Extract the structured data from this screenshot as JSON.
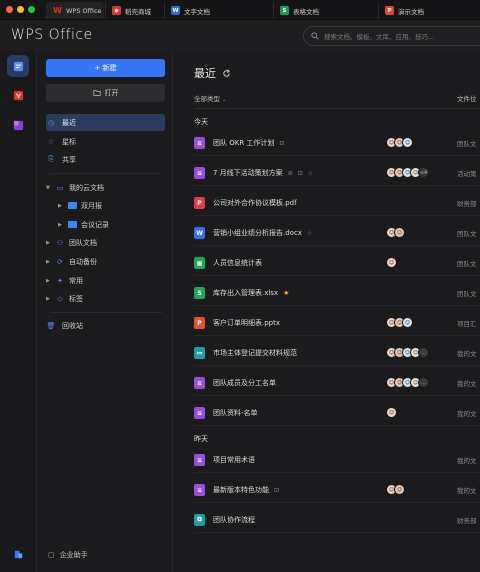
{
  "tabs": [
    {
      "label": "WPS Office",
      "icon": "wps-logo-icon",
      "color": "#e0301e"
    },
    {
      "label": "稻壳商城",
      "icon": "docer-store-icon",
      "color": "#d83a2a"
    },
    {
      "label": "文字文档",
      "icon": "W",
      "color": "#2f6ae6"
    },
    {
      "label": "表格文档",
      "icon": "S",
      "color": "#1c9b5a"
    },
    {
      "label": "演示文档",
      "icon": "P",
      "color": "#e2452b"
    }
  ],
  "header": {
    "app_title": "WPS Office",
    "search_placeholder": "搜索文档、模板、文库、应用、技巧..."
  },
  "sidebar": {
    "new_label": "+ 新建",
    "open_label": "打开",
    "nav": [
      {
        "label": "最近",
        "icon": "clock-icon"
      },
      {
        "label": "星标",
        "icon": "star-icon"
      },
      {
        "label": "共享",
        "icon": "share-icon"
      }
    ],
    "tree": [
      {
        "label": "我的云文档",
        "icon": "folder-outline-icon"
      },
      {
        "label": "双月报",
        "icon": "folder-icon"
      },
      {
        "label": "会议记录",
        "icon": "folder-icon"
      },
      {
        "label": "团队文档",
        "icon": "team-icon"
      },
      {
        "label": "自动备份",
        "icon": "backup-icon"
      },
      {
        "label": "常用",
        "icon": "pin-icon"
      },
      {
        "label": "标签",
        "icon": "tag-icon"
      }
    ],
    "trash_label": "回收站",
    "helper_label": "企业助手"
  },
  "main": {
    "title": "最近",
    "filter_label": "全部类型",
    "location_header": "文件位",
    "groups": [
      {
        "label": "今天",
        "files": [
          {
            "name": "团队 OKR 工作计划",
            "type": "doc",
            "icon": "≡",
            "color": "#9b4ddb",
            "marks": [
              "lock-icon"
            ],
            "avatars": 3,
            "more": "",
            "location": "团队文"
          },
          {
            "name": "7 月线下活动策划方案",
            "type": "doc",
            "icon": "≡",
            "color": "#9b4ddb",
            "marks": [
              "link-icon",
              "lock-icon",
              "star-icon"
            ],
            "avatars": 4,
            "more": "+4",
            "location": "活动策"
          },
          {
            "name": "公司对外合作协议模板.pdf",
            "type": "pdf",
            "icon": "P",
            "color": "#e03b4a",
            "marks": [],
            "avatars": 0,
            "more": "",
            "location": "财务部"
          },
          {
            "name": "营销小组业绩分析报告.docx",
            "type": "docx",
            "icon": "W",
            "color": "#3a6de8",
            "marks": [
              "star-icon"
            ],
            "avatars": 2,
            "more": "",
            "location": "团队文"
          },
          {
            "name": "人员信息统计表",
            "type": "sheet",
            "icon": "▦",
            "color": "#22a55d",
            "marks": [],
            "avatars": 1,
            "more": "",
            "location": "团队文"
          },
          {
            "name": "库存出入管理表.xlsx",
            "type": "xlsx",
            "icon": "S",
            "color": "#22a55d",
            "marks": [
              "star-filled-icon"
            ],
            "avatars": 0,
            "more": "",
            "location": "团队文"
          },
          {
            "name": "客户订单明细表.pptx",
            "type": "pptx",
            "icon": "P",
            "color": "#e5532c",
            "marks": [],
            "avatars": 3,
            "more": "",
            "location": "项目汇"
          },
          {
            "name": "市场主体登记提交材料规范",
            "type": "form",
            "icon": "≔",
            "color": "#1f9aa8",
            "marks": [],
            "avatars": 4,
            "more": "…",
            "location": "我的文"
          },
          {
            "name": "团队成员及分工名单",
            "type": "doc",
            "icon": "≡",
            "color": "#9b4ddb",
            "marks": [],
            "avatars": 4,
            "more": "…",
            "location": "我的文"
          },
          {
            "name": "团队资料-名单",
            "type": "doc",
            "icon": "≡",
            "color": "#9b4ddb",
            "marks": [],
            "avatars": 1,
            "more": "",
            "location": "我的文"
          }
        ]
      },
      {
        "label": "昨天",
        "files": [
          {
            "name": "项目常用术语",
            "type": "doc",
            "icon": "≡",
            "color": "#9b4ddb",
            "marks": [],
            "avatars": 0,
            "more": "",
            "location": "我的文"
          },
          {
            "name": "最新版本特色功能",
            "type": "doc",
            "icon": "≡",
            "color": "#9b4ddb",
            "marks": [
              "lock-icon"
            ],
            "avatars": 2,
            "more": "",
            "location": "我的文"
          },
          {
            "name": "团队协作流程",
            "type": "flow",
            "icon": "⧉",
            "color": "#1f9aa8",
            "marks": [],
            "avatars": 0,
            "more": "",
            "location": "财务部"
          }
        ]
      }
    ]
  }
}
